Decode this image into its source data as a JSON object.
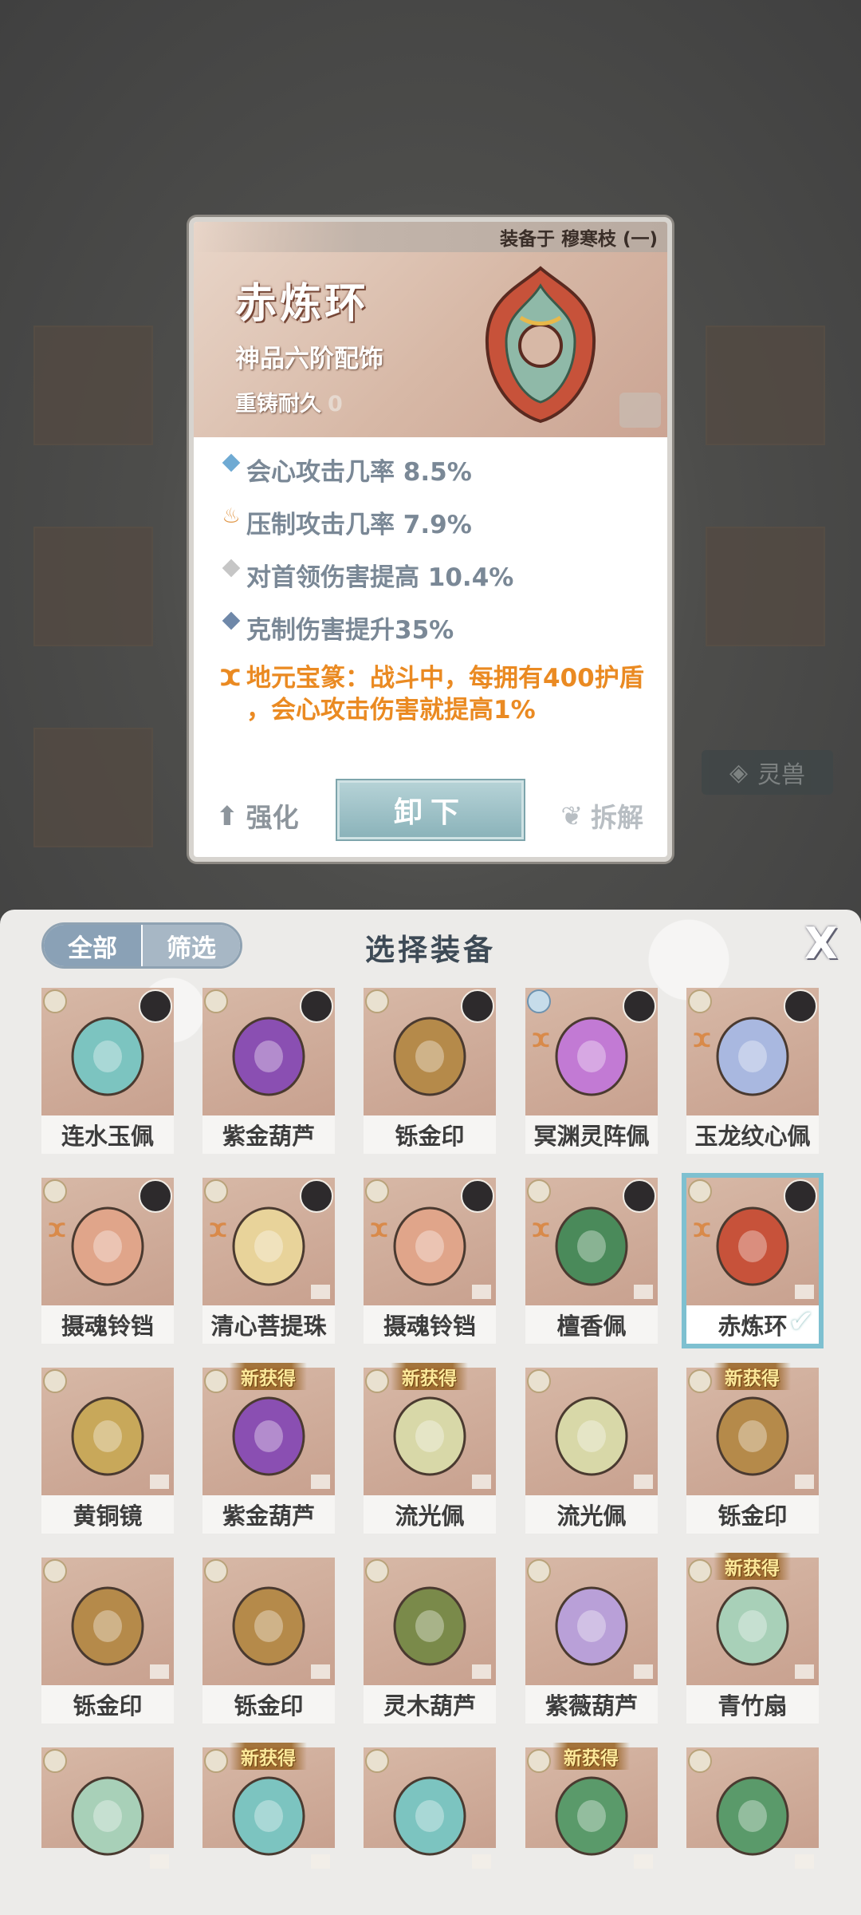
{
  "detail": {
    "equipped_to": "装备于 穆寒枝 (一)",
    "name": "赤炼环",
    "grade": "神品六阶配饰",
    "reforge_label": "重铸耐久",
    "reforge_value": "0",
    "stats": [
      {
        "icon": "diamond-blue-icon",
        "text": "会心攻击几率 8.5%",
        "color": "#6faad3"
      },
      {
        "icon": "flame-icon",
        "text": "压制攻击几率 7.9%",
        "color": "#e0984a"
      },
      {
        "icon": "diamond-gray-icon",
        "text": "对首领伤害提高 10.4%",
        "color": "#c6c6c6"
      },
      {
        "icon": "diamond-navy-icon",
        "text": "克制伤害提升35%",
        "color": "#6f88a9"
      }
    ],
    "special": "地元宝篆：战斗中，每拥有400护盾，会心攻击伤害就提高1%",
    "special_line1": "地元宝篆：战斗中，每拥有400护盾",
    "special_line2": "，会心攻击伤害就提高1%",
    "strengthen_label": "强化",
    "unequip_label": "卸下",
    "dismantle_label": "拆解"
  },
  "background": {
    "beast_label": "灵兽"
  },
  "panel": {
    "filter_all": "全部",
    "filter_screen": "筛选",
    "title": "选择装备",
    "close": "X"
  },
  "items": [
    {
      "name": "连水玉佩",
      "new": false,
      "avatar": true,
      "color": "#7cc4c0"
    },
    {
      "name": "紫金葫芦",
      "new": false,
      "avatar": true,
      "color": "#8a4fb2"
    },
    {
      "name": "铄金印",
      "new": false,
      "avatar": true,
      "color": "#b58a4a"
    },
    {
      "name": "冥渊灵阵佩",
      "new": false,
      "avatar": true,
      "color": "#c27ad4"
    },
    {
      "name": "玉龙纹心佩",
      "new": false,
      "avatar": true,
      "color": "#a9b8e0"
    },
    {
      "name": "摄魂铃铛",
      "new": false,
      "avatar": true,
      "color": "#e0a58a"
    },
    {
      "name": "清心菩提珠",
      "new": false,
      "avatar": true,
      "color": "#e8d39a"
    },
    {
      "name": "摄魂铃铛",
      "new": false,
      "avatar": true,
      "color": "#e0a58a"
    },
    {
      "name": "檀香佩",
      "new": false,
      "avatar": true,
      "color": "#4a8a5a"
    },
    {
      "name": "赤炼环",
      "new": false,
      "avatar": true,
      "color": "#c7523a",
      "selected": true
    },
    {
      "name": "黄铜镜",
      "new": false,
      "avatar": false,
      "color": "#c8a85a"
    },
    {
      "name": "紫金葫芦",
      "new": true,
      "avatar": false,
      "color": "#8a4fb2"
    },
    {
      "name": "流光佩",
      "new": true,
      "avatar": false,
      "color": "#d8d8a8"
    },
    {
      "name": "流光佩",
      "new": false,
      "avatar": false,
      "color": "#d8d8a8"
    },
    {
      "name": "铄金印",
      "new": true,
      "avatar": false,
      "color": "#b58a4a"
    },
    {
      "name": "铄金印",
      "new": false,
      "avatar": false,
      "color": "#b58a4a"
    },
    {
      "name": "铄金印",
      "new": false,
      "avatar": false,
      "color": "#b58a4a"
    },
    {
      "name": "灵木葫芦",
      "new": false,
      "avatar": false,
      "color": "#7a8a4a"
    },
    {
      "name": "紫薇葫芦",
      "new": false,
      "avatar": false,
      "color": "#b9a0d8"
    },
    {
      "name": "青竹扇",
      "new": true,
      "avatar": false,
      "color": "#a8d0b8"
    },
    {
      "name": "",
      "new": false,
      "avatar": false,
      "color": "#a8d0b8"
    },
    {
      "name": "",
      "new": true,
      "avatar": false,
      "color": "#7cc4c0"
    },
    {
      "name": "",
      "new": false,
      "avatar": false,
      "color": "#7cc4c0"
    },
    {
      "name": "",
      "new": true,
      "avatar": false,
      "color": "#5a9a6a"
    },
    {
      "name": "",
      "new": false,
      "avatar": false,
      "color": "#5a9a6a"
    }
  ],
  "new_badge_label": "新获得",
  "check_mark": "✔"
}
